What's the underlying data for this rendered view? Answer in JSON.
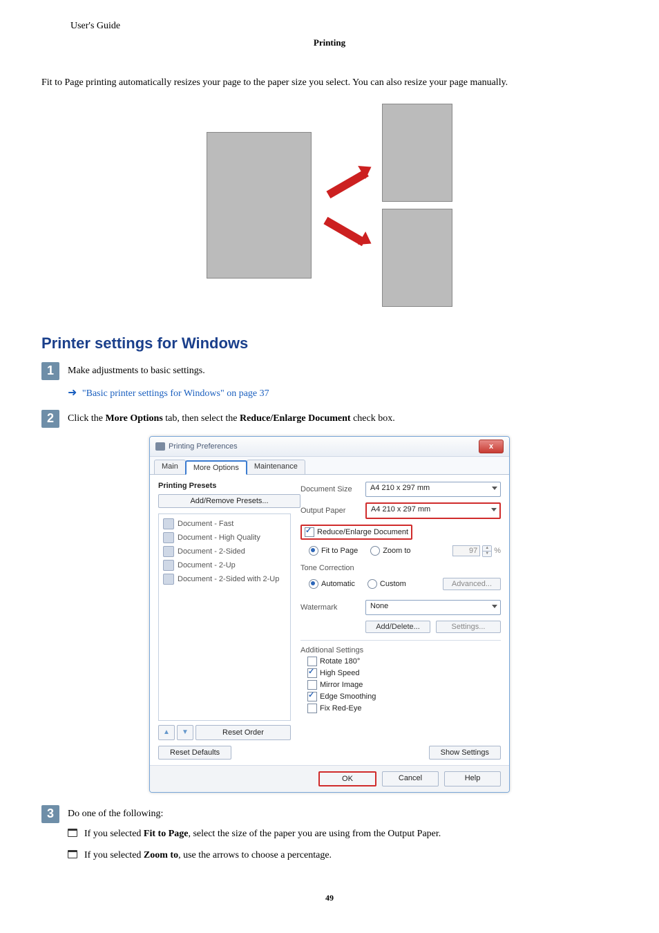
{
  "header": {
    "left": "User's Guide",
    "center": "Printing"
  },
  "intro": "Fit to Page printing automatically resizes your page to the paper size you select. You can also resize your page manually.",
  "section_title": "Printer settings for Windows",
  "steps": {
    "s1": {
      "text": "Make adjustments to basic settings.",
      "link": "\"Basic printer settings for Windows\" on page 37"
    },
    "s2": {
      "pre": "Click the ",
      "b1": "More Options",
      "mid": " tab, then select the ",
      "b2": "Reduce/Enlarge Document",
      "post": " check box."
    },
    "s3": {
      "text": "Do one of the following:",
      "li1_pre": "If you selected ",
      "li1_b": "Fit to Page",
      "li1_post": ", select the size of the paper you are using from the Output Paper.",
      "li2_pre": "If you selected ",
      "li2_b": "Zoom to",
      "li2_post": ", use the arrows to choose a percentage."
    }
  },
  "dialog": {
    "title": "Printing Preferences",
    "close": "x",
    "tabs": {
      "main": "Main",
      "more": "More Options",
      "maint": "Maintenance"
    },
    "presets_h": "Printing Presets",
    "add_remove": "Add/Remove Presets...",
    "presets": [
      "Document - Fast",
      "Document - High Quality",
      "Document - 2-Sided",
      "Document - 2-Up",
      "Document - 2-Sided with 2-Up"
    ],
    "reset_order": "Reset Order",
    "reset_defaults": "Reset Defaults",
    "show_settings": "Show Settings",
    "ok": "OK",
    "cancel": "Cancel",
    "help": "Help",
    "doc_size_l": "Document Size",
    "doc_size_v": "A4 210 x 297 mm",
    "out_paper_l": "Output Paper",
    "out_paper_v": "A4 210 x 297 mm",
    "reduce_enlarge": "Reduce/Enlarge Document",
    "fit_to_page": "Fit to Page",
    "zoom_to": "Zoom to",
    "zoom_val": "97",
    "zoom_unit": "%",
    "tone_l": "Tone Correction",
    "auto": "Automatic",
    "custom": "Custom",
    "advanced": "Advanced...",
    "watermark_l": "Watermark",
    "watermark_v": "None",
    "add_delete": "Add/Delete...",
    "settings": "Settings...",
    "addl_l": "Additional Settings",
    "rotate": "Rotate 180°",
    "high_speed": "High Speed",
    "mirror": "Mirror Image",
    "edge_smooth": "Edge Smoothing",
    "fix_redeye": "Fix Red-Eye"
  },
  "page_num": "49"
}
